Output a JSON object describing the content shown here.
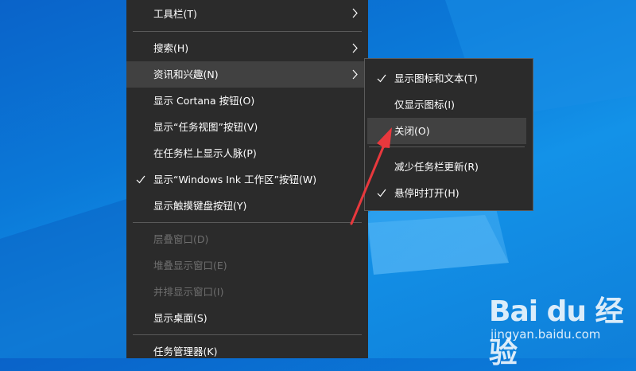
{
  "main_menu": {
    "items": [
      {
        "label": "工具栏(T)",
        "submenu": true
      },
      {
        "label": "搜索(H)",
        "submenu": true
      },
      {
        "label": "资讯和兴趣(N)",
        "submenu": true,
        "highlighted": true
      },
      {
        "label": "显示 Cortana 按钮(O)"
      },
      {
        "label": "显示“任务视图”按钮(V)"
      },
      {
        "label": "在任务栏上显示人脉(P)"
      },
      {
        "label": "显示“Windows Ink 工作区”按钮(W)",
        "checked": true
      },
      {
        "label": "显示触摸键盘按钮(Y)"
      },
      {
        "label": "层叠窗口(D)",
        "disabled": true
      },
      {
        "label": "堆叠显示窗口(E)",
        "disabled": true
      },
      {
        "label": "并排显示窗口(I)",
        "disabled": true
      },
      {
        "label": "显示桌面(S)"
      },
      {
        "label": "任务管理器(K)"
      }
    ]
  },
  "sub_menu": {
    "items": [
      {
        "label": "显示图标和文本(T)",
        "checked": true
      },
      {
        "label": "仅显示图标(I)"
      },
      {
        "label": "关闭(O)",
        "highlighted": true
      },
      {
        "label": "减少任务栏更新(R)"
      },
      {
        "label": "悬停时打开(H)",
        "checked": true
      }
    ]
  },
  "watermark": {
    "brand_text": "Bai du 经验",
    "url": "jingyan.baidu.com"
  },
  "colors": {
    "menu_bg": "#2b2b2b",
    "highlight": "#414141",
    "annotation_arrow": "#e8383d"
  }
}
